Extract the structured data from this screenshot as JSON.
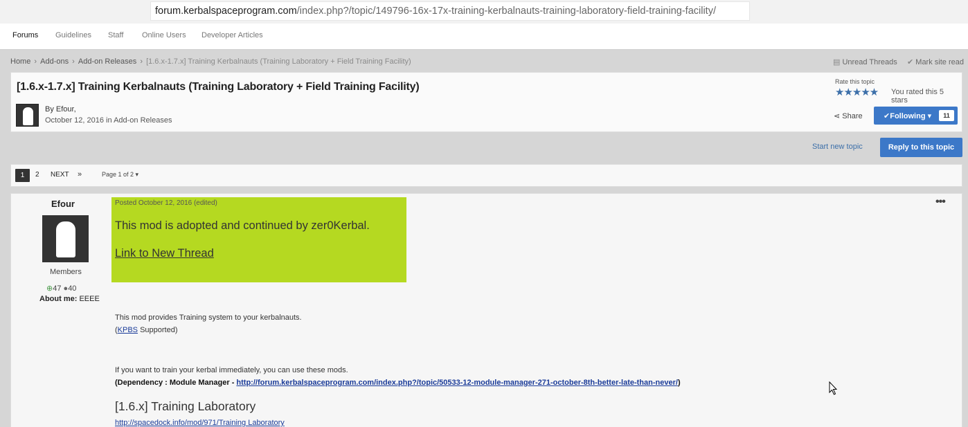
{
  "browser": {
    "url_domain": "forum.kerbalspaceprogram.com",
    "url_path": "/index.php?/topic/149796-16x-17x-training-kerbalnauts-training-laboratory-field-training-facility/"
  },
  "nav": {
    "items": [
      "Forums",
      "Guidelines",
      "Staff",
      "Online Users",
      "Developer Articles"
    ]
  },
  "breadcrumb": {
    "items": [
      "Home",
      "Add-ons",
      "Add-on Releases"
    ],
    "current": "[1.6.x-1.7.x] Training Kerbalnauts (Training Laboratory + Field Training Facility)",
    "unread_threads": "Unread Threads",
    "mark_read": "Mark site read"
  },
  "topic": {
    "title": "[1.6.x-1.7.x] Training Kerbalnauts (Training Laboratory + Field Training Facility)",
    "by": "By Efour,",
    "date_line": "October 12, 2016 in Add-on Releases",
    "rate_label": "Rate this topic",
    "stars": "★★★★★",
    "rated_text": "You rated this 5 stars",
    "share_label": "Share",
    "following_label": "Following",
    "follower_count": "11"
  },
  "actions": {
    "start_new_topic": "Start new topic",
    "reply": "Reply to this topic"
  },
  "pagination": {
    "page1": "1",
    "page2": "2",
    "next": "NEXT",
    "last": "»",
    "page_of": "Page 1 of 2"
  },
  "post": {
    "author": "Efour",
    "member_group": "Members",
    "reputation": "47",
    "post_count": "40",
    "about_label": "About me:",
    "about_value": "EEEE",
    "posted_line": "Posted October 12, 2016 (edited)",
    "adopted_text": "This mod is adopted and continued by zer0Kerbal.",
    "new_thread_link": "Link to New Thread",
    "intro_line1": "This mod provides Training system to your kerbalnauts.",
    "intro_line2_prefix": "(",
    "kpbs_link": "KPBS",
    "intro_line2_suffix": " Supported)",
    "train_line": "If you want to train your kerbal immediately, you can use these mods.",
    "dependency_prefix": "(Dependency : Module Manager - ",
    "dependency_link": "http://forum.kerbalspaceprogram.com/index.php?/topic/50533-12-module-manager-271-october-8th-better-late-than-never/",
    "dependency_suffix": ")",
    "section_heading": "[1.6.x] Training Laboratory",
    "spacedock_link": "http://spacedock.info/mod/971/Training Laboratory"
  }
}
